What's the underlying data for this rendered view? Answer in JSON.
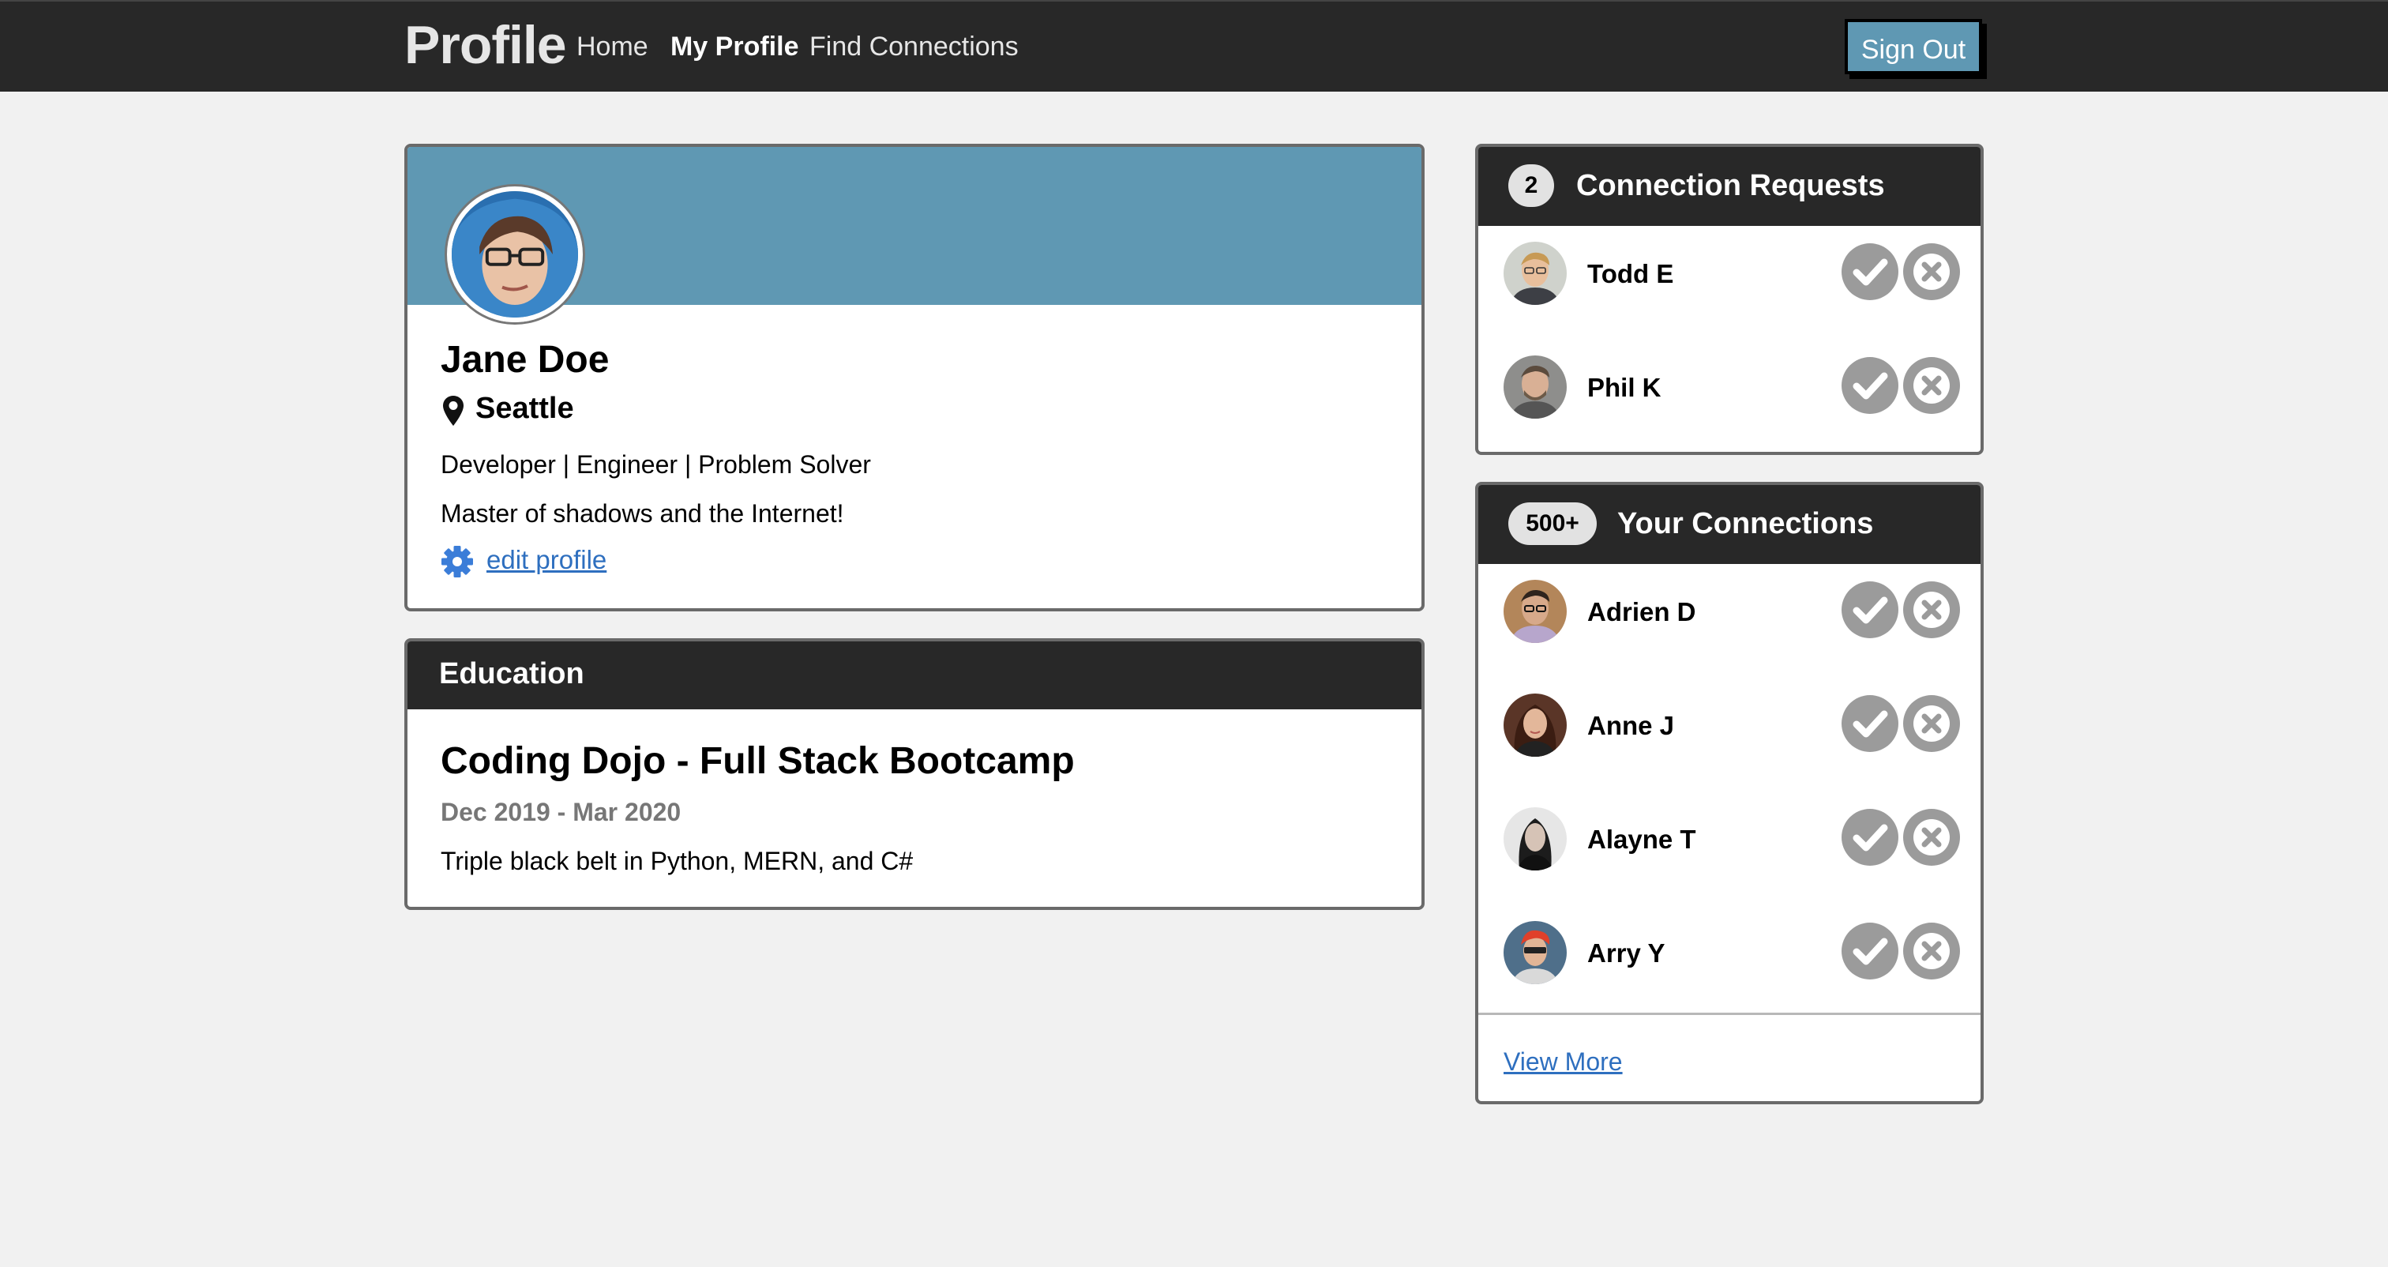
{
  "header": {
    "brand": "Profile",
    "nav": [
      {
        "label": "Home",
        "active": false
      },
      {
        "label": "My Profile",
        "active": true
      },
      {
        "label": "Find Connections",
        "active": false
      }
    ],
    "sign_out": "Sign Out"
  },
  "profile": {
    "name": "Jane Doe",
    "location": "Seattle",
    "headline": "Developer | Engineer | Problem Solver",
    "bio": "Master of shadows and the Internet!",
    "edit_label": "edit profile"
  },
  "education": {
    "heading": "Education",
    "school": "Coding Dojo - Full Stack Bootcamp",
    "dates": "Dec 2019 - Mar 2020",
    "description": "Triple black belt in Python, MERN, and C#"
  },
  "requests": {
    "count": "2",
    "title": "Connection Requests",
    "people": [
      {
        "name": "Todd E"
      },
      {
        "name": "Phil K"
      }
    ]
  },
  "connections": {
    "count": "500+",
    "title": "Your Connections",
    "people": [
      {
        "name": "Adrien D"
      },
      {
        "name": "Anne J"
      },
      {
        "name": "Alayne T"
      },
      {
        "name": "Arry Y"
      }
    ],
    "view_more": "View More"
  },
  "colors": {
    "navbar": "#282828",
    "accent_blue": "#5f98b3",
    "link_blue": "#2e6fbf",
    "action_grey": "#9b9b9b"
  }
}
